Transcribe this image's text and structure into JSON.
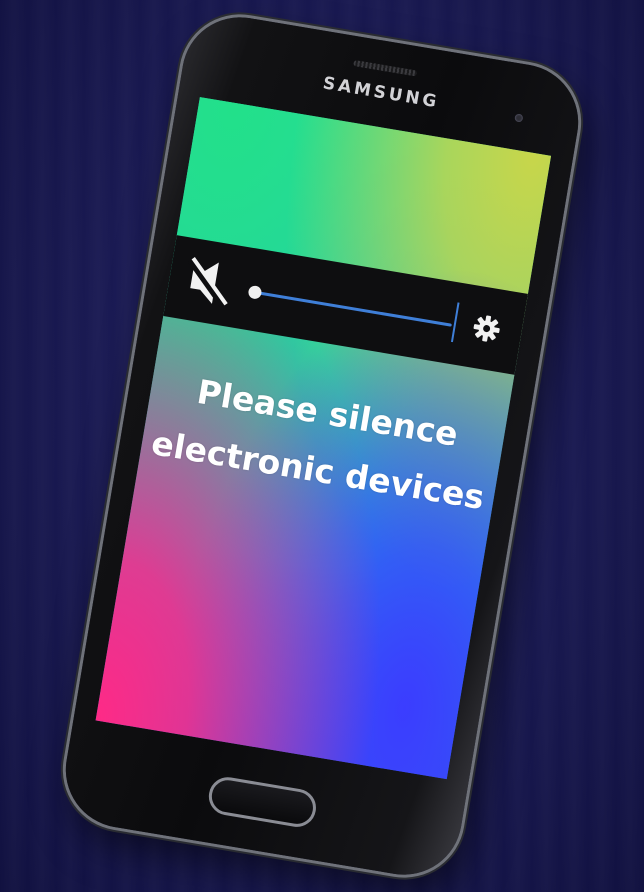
{
  "device": {
    "brand": "SAMSUNG"
  },
  "volume_panel": {
    "icon": "speaker-muted-icon",
    "level": 0,
    "settings_icon": "gear-icon",
    "accent_color": "#3f7fd8"
  },
  "screen": {
    "message_line1": "Please silence",
    "message_line2": "electronic devices"
  }
}
